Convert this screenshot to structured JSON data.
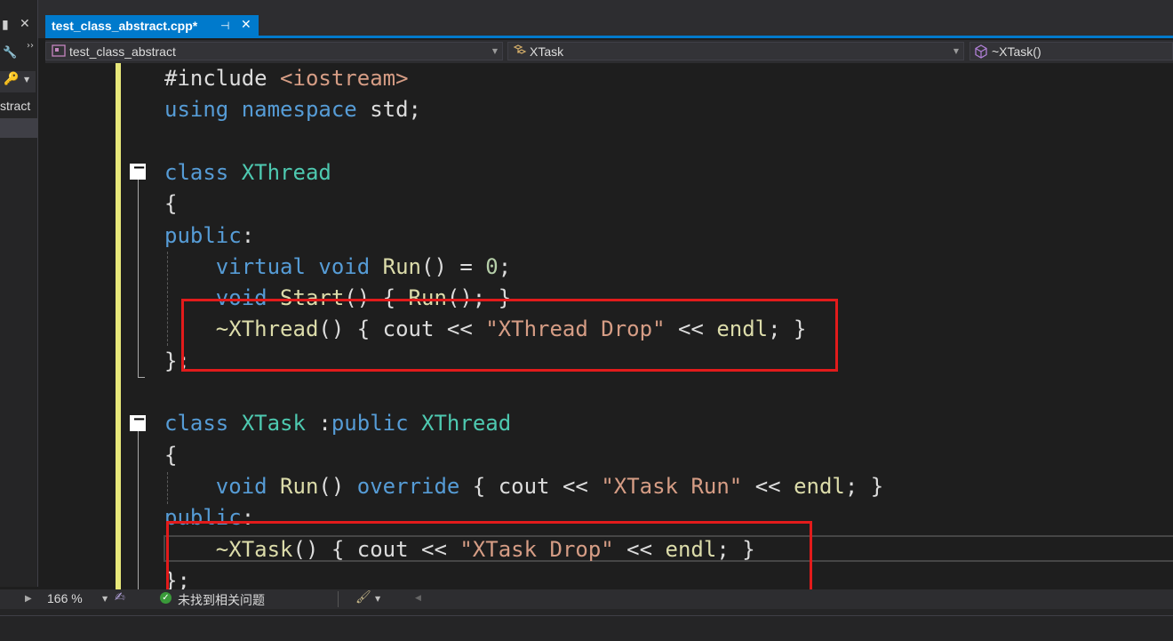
{
  "left_panel": {
    "pin_glyph": "▮",
    "close_glyph": "✕",
    "tool_icon": "wrench-icon",
    "search_icon": "key-icon",
    "item_label": "stract"
  },
  "tab": {
    "title": "test_class_abstract.cpp*",
    "pin_glyph": "⊣",
    "close_glyph": "✕"
  },
  "nav": {
    "project": "test_class_abstract",
    "scope": "XTask",
    "member": "~XTask()"
  },
  "code": {
    "lines": [
      [
        {
          "t": "#include ",
          "c": "plain"
        },
        {
          "t": "<iostream>",
          "c": "str"
        }
      ],
      [
        {
          "t": "using",
          "c": "kw"
        },
        {
          "t": " ",
          "c": "plain"
        },
        {
          "t": "namespace",
          "c": "kw"
        },
        {
          "t": " std;",
          "c": "plain"
        }
      ],
      [],
      [
        {
          "t": "class",
          "c": "kw"
        },
        {
          "t": " ",
          "c": "plain"
        },
        {
          "t": "XThread",
          "c": "ty"
        }
      ],
      [
        {
          "t": "{",
          "c": "plain"
        }
      ],
      [
        {
          "t": "public",
          "c": "kw"
        },
        {
          "t": ":",
          "c": "plain"
        }
      ],
      [
        {
          "t": "    ",
          "c": "plain"
        },
        {
          "t": "virtual",
          "c": "kw"
        },
        {
          "t": " ",
          "c": "plain"
        },
        {
          "t": "void",
          "c": "kw"
        },
        {
          "t": " ",
          "c": "plain"
        },
        {
          "t": "Run",
          "c": "fn"
        },
        {
          "t": "() = ",
          "c": "plain"
        },
        {
          "t": "0",
          "c": "num"
        },
        {
          "t": ";",
          "c": "plain"
        }
      ],
      [
        {
          "t": "    ",
          "c": "plain"
        },
        {
          "t": "void",
          "c": "kw"
        },
        {
          "t": " ",
          "c": "plain"
        },
        {
          "t": "Start",
          "c": "fn"
        },
        {
          "t": "() { ",
          "c": "plain"
        },
        {
          "t": "Run",
          "c": "fn"
        },
        {
          "t": "(); }",
          "c": "plain"
        }
      ],
      [
        {
          "t": "    ",
          "c": "plain"
        },
        {
          "t": "~XThread",
          "c": "fn"
        },
        {
          "t": "() { cout << ",
          "c": "plain"
        },
        {
          "t": "\"XThread Drop\"",
          "c": "str"
        },
        {
          "t": " << ",
          "c": "plain"
        },
        {
          "t": "endl",
          "c": "fn"
        },
        {
          "t": "; }",
          "c": "plain"
        }
      ],
      [
        {
          "t": "};",
          "c": "plain"
        }
      ],
      [],
      [
        {
          "t": "class",
          "c": "kw"
        },
        {
          "t": " ",
          "c": "plain"
        },
        {
          "t": "XTask",
          "c": "ty"
        },
        {
          "t": " :",
          "c": "plain"
        },
        {
          "t": "public",
          "c": "kw"
        },
        {
          "t": " ",
          "c": "plain"
        },
        {
          "t": "XThread",
          "c": "ty"
        }
      ],
      [
        {
          "t": "{",
          "c": "plain"
        }
      ],
      [
        {
          "t": "    ",
          "c": "plain"
        },
        {
          "t": "void",
          "c": "kw"
        },
        {
          "t": " ",
          "c": "plain"
        },
        {
          "t": "Run",
          "c": "fn"
        },
        {
          "t": "() ",
          "c": "plain"
        },
        {
          "t": "override",
          "c": "kw"
        },
        {
          "t": " { cout << ",
          "c": "plain"
        },
        {
          "t": "\"XTask Run\"",
          "c": "str"
        },
        {
          "t": " << ",
          "c": "plain"
        },
        {
          "t": "endl",
          "c": "fn"
        },
        {
          "t": "; }",
          "c": "plain"
        }
      ],
      [
        {
          "t": "public",
          "c": "kw"
        },
        {
          "t": ":",
          "c": "plain"
        }
      ],
      [
        {
          "t": "    ",
          "c": "plain"
        },
        {
          "t": "~XTask",
          "c": "fn"
        },
        {
          "t": "() { cout << ",
          "c": "plain"
        },
        {
          "t": "\"XTask Drop\"",
          "c": "str"
        },
        {
          "t": " << ",
          "c": "plain"
        },
        {
          "t": "endl",
          "c": "fn"
        },
        {
          "t": "; }",
          "c": "plain"
        }
      ],
      [
        {
          "t": "};",
          "c": "plain"
        }
      ]
    ],
    "colors": {
      "plain": "#dcdcdc",
      "kw": "#569cd6",
      "ty": "#4ec9b0",
      "fn": "#dcdcaa",
      "str": "#d69d85",
      "num": "#b5cea8"
    },
    "collapse_glyph": "−"
  },
  "status": {
    "zoom": "166 %",
    "issues": "未找到相关问题",
    "ok_glyph": "✓"
  },
  "accent_color": "#007acc",
  "highlight_color": "#e21b1b"
}
